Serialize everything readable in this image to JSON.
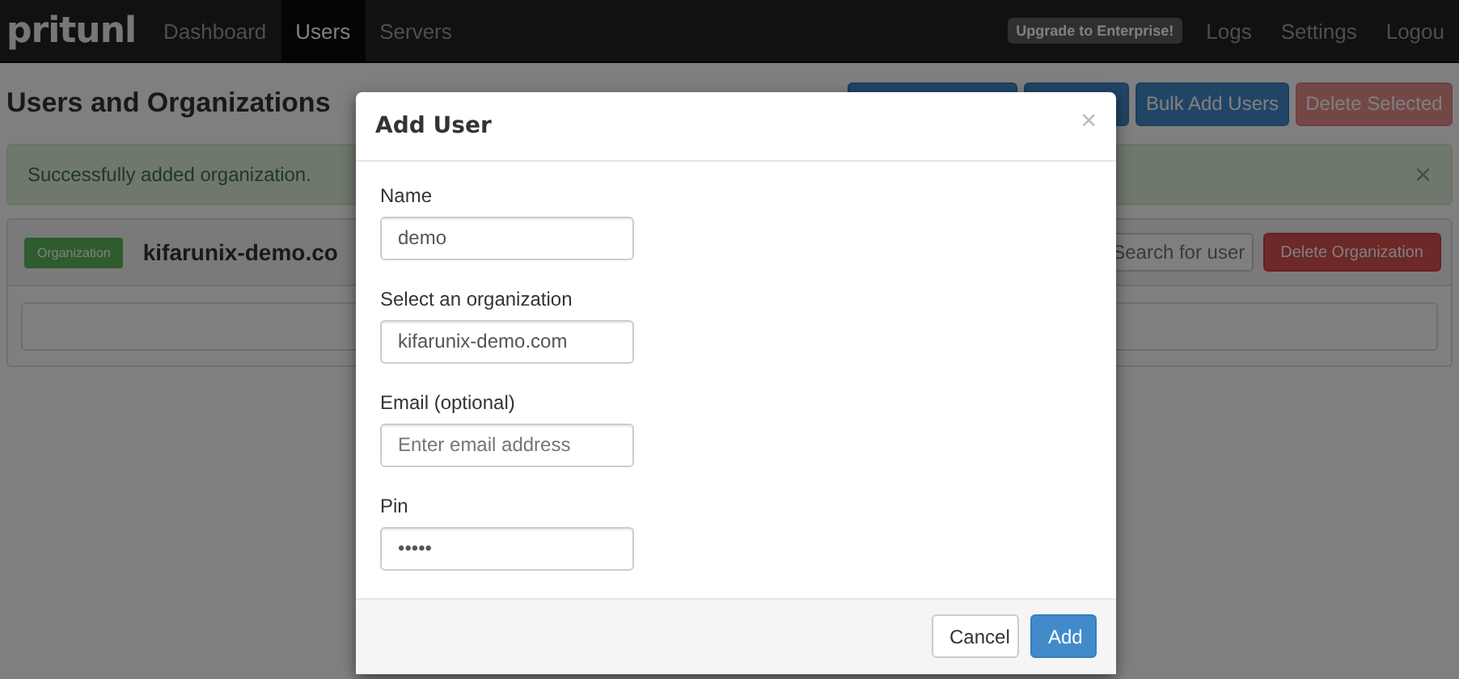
{
  "navbar": {
    "logo": "pritunl",
    "links": [
      {
        "label": "Dashboard",
        "selected": false
      },
      {
        "label": "Users",
        "selected": true
      },
      {
        "label": "Servers",
        "selected": false
      }
    ],
    "upgrade_badge": "Upgrade to Enterprise!",
    "right_links": [
      "Logs",
      "Settings",
      "Logou"
    ]
  },
  "page": {
    "title": "Users and Organizations",
    "buttons": [
      {
        "kind": "primary"
      },
      {
        "kind": "primary"
      },
      {
        "label": "Bulk Add Users",
        "kind": "primary"
      },
      {
        "label": "Delete Selected",
        "kind": "danger-disabled"
      }
    ],
    "alert": {
      "text": "Successfully added organization.",
      "close": "×"
    },
    "organization": {
      "tag": "Organization",
      "name": "kifarunix-demo.co",
      "search": {
        "placeholder": "Search for user"
      },
      "delete_button": "Delete Organization"
    }
  },
  "modal": {
    "title": "Add User",
    "close": "×",
    "fields": [
      {
        "label": "Name",
        "value": "demo"
      },
      {
        "label": "Select an organization",
        "value": "kifarunix-demo.com"
      },
      {
        "label": "Email (optional)",
        "placeholder": "Enter email address"
      },
      {
        "label": "Pin",
        "value": "•••••"
      }
    ],
    "buttons": [
      {
        "label": "Cancel",
        "kind": "default"
      },
      {
        "label": "Add",
        "kind": "primary"
      }
    ]
  }
}
